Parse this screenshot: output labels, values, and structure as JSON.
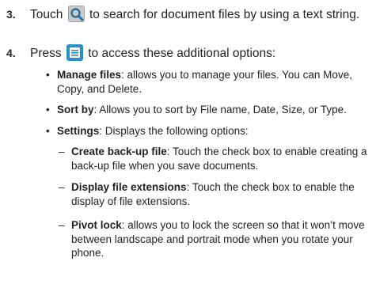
{
  "steps": [
    {
      "number": "3.",
      "before_icon": "Touch",
      "icon": "search-icon",
      "after_icon": "to search for document files by using a text string."
    },
    {
      "number": "4.",
      "before_icon": "Press",
      "icon": "menu-icon",
      "after_icon": "to access these additional options:"
    }
  ],
  "options": [
    {
      "term": "Manage files",
      "description": ": allows you to manage your files. You can Move, Copy, and Delete."
    },
    {
      "term": "Sort by",
      "description": ": Allows you to sort by File name, Date, Size, or Type."
    },
    {
      "term": "Settings",
      "description": ": Displays the following options:"
    }
  ],
  "settings_options": [
    {
      "term": "Create back-up file",
      "description": ": Touch the check box to enable creating a back-up file when you save documents."
    },
    {
      "term": "Display file extensions",
      "description": ": Touch the check box to enable the display of file extensions."
    },
    {
      "term": "Pivot lock",
      "description": ": allows you to lock the screen so that it won’t move between landscape and portrait mode when you rotate your phone."
    }
  ],
  "colors": {
    "text": "#231f20",
    "menu_icon_bg": "#2a8ec7",
    "search_icon_bg": "#c9cacb"
  }
}
